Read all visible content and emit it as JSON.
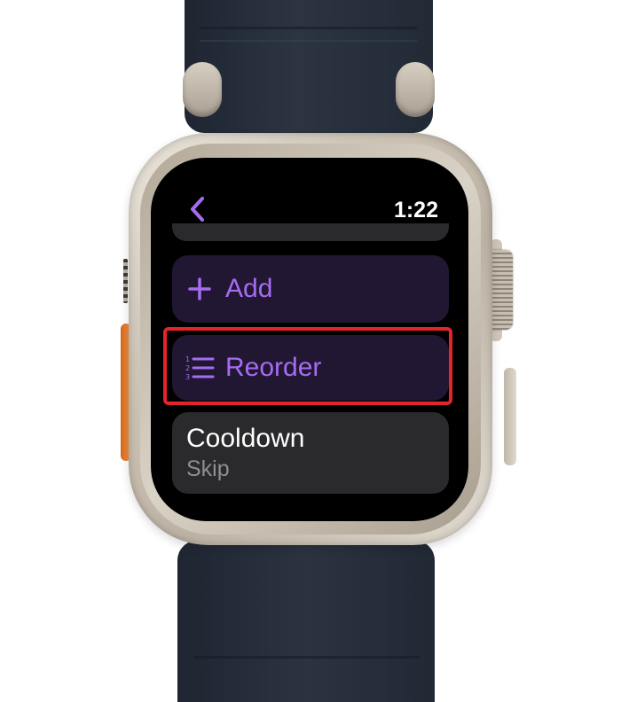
{
  "status_bar": {
    "time": "1:22"
  },
  "list": {
    "add_label": "Add",
    "reorder_label": "Reorder",
    "cooldown": {
      "title": "Cooldown",
      "subtitle": "Skip"
    }
  },
  "icons": {
    "back": "chevron-left-icon",
    "add": "plus-icon",
    "reorder": "numbered-list-icon"
  },
  "colors": {
    "accent": "#a56cf0",
    "accent_card": "#211733",
    "highlight": "#e5232a"
  }
}
